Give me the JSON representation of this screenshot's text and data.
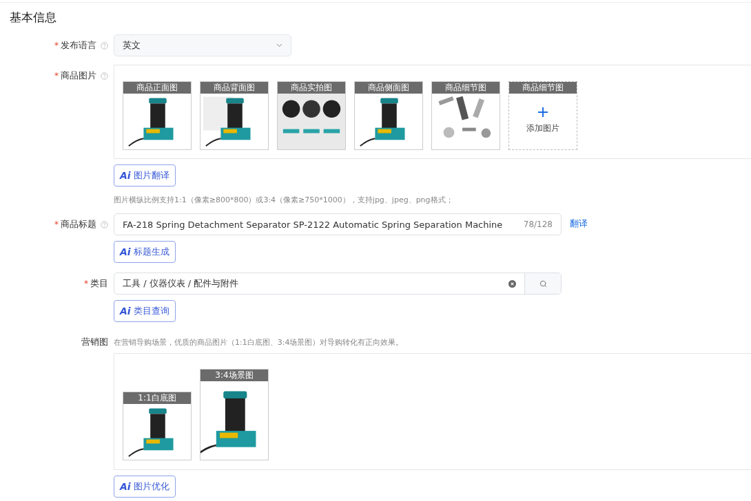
{
  "section_title": "基本信息",
  "fields": [
    {
      "kind": "select",
      "marker": "*",
      "label": "发布语言",
      "help": true,
      "value": "英文"
    },
    {
      "kind": "images",
      "marker": "*",
      "label": "商品图片",
      "help": true,
      "images": [
        {
          "kind": "picture",
          "caption": "商品正面图"
        },
        {
          "kind": "picture",
          "caption": "商品背面图"
        },
        {
          "kind": "picture",
          "caption": "商品实拍图"
        },
        {
          "kind": "picture",
          "caption": "商品侧面图"
        },
        {
          "kind": "picture",
          "caption": "商品细节图"
        },
        {
          "kind": "add",
          "caption": "商品细节图",
          "action": "添加图片"
        }
      ],
      "ai_button": {
        "badge": "Ai",
        "label": "图片翻译"
      },
      "hint": "图片横纵比例支持1:1（像素≥800*800）或3:4（像素≥750*1000），支持jpg、jpeg、png格式；"
    },
    {
      "kind": "text",
      "marker": "*",
      "label": "商品标题",
      "help": true,
      "value": "FA-218 Spring Detachment Separator SP-2122 Automatic Spring Separation Machine",
      "counter": "78/128",
      "link": "翻译",
      "ai_button": {
        "badge": "Ai",
        "label": "标题生成"
      }
    },
    {
      "kind": "category",
      "marker": "*",
      "label": "类目",
      "help": false,
      "value": "工具 / 仪器仪表 / 配件与附件",
      "ai_button": {
        "badge": "Ai",
        "label": "类目查询"
      }
    },
    {
      "kind": "marketing",
      "label": "营销图",
      "help": false,
      "description": "在营销导购场景，优质的商品图片（1:1白底图、3:4场景图）对导购转化有正向效果。",
      "images": [
        {
          "kind": "square",
          "caption": "1:1白底图"
        },
        {
          "kind": "portrait",
          "caption": "3:4场景图"
        }
      ],
      "ai_button": {
        "badge": "Ai",
        "label": "图片优化"
      }
    }
  ]
}
